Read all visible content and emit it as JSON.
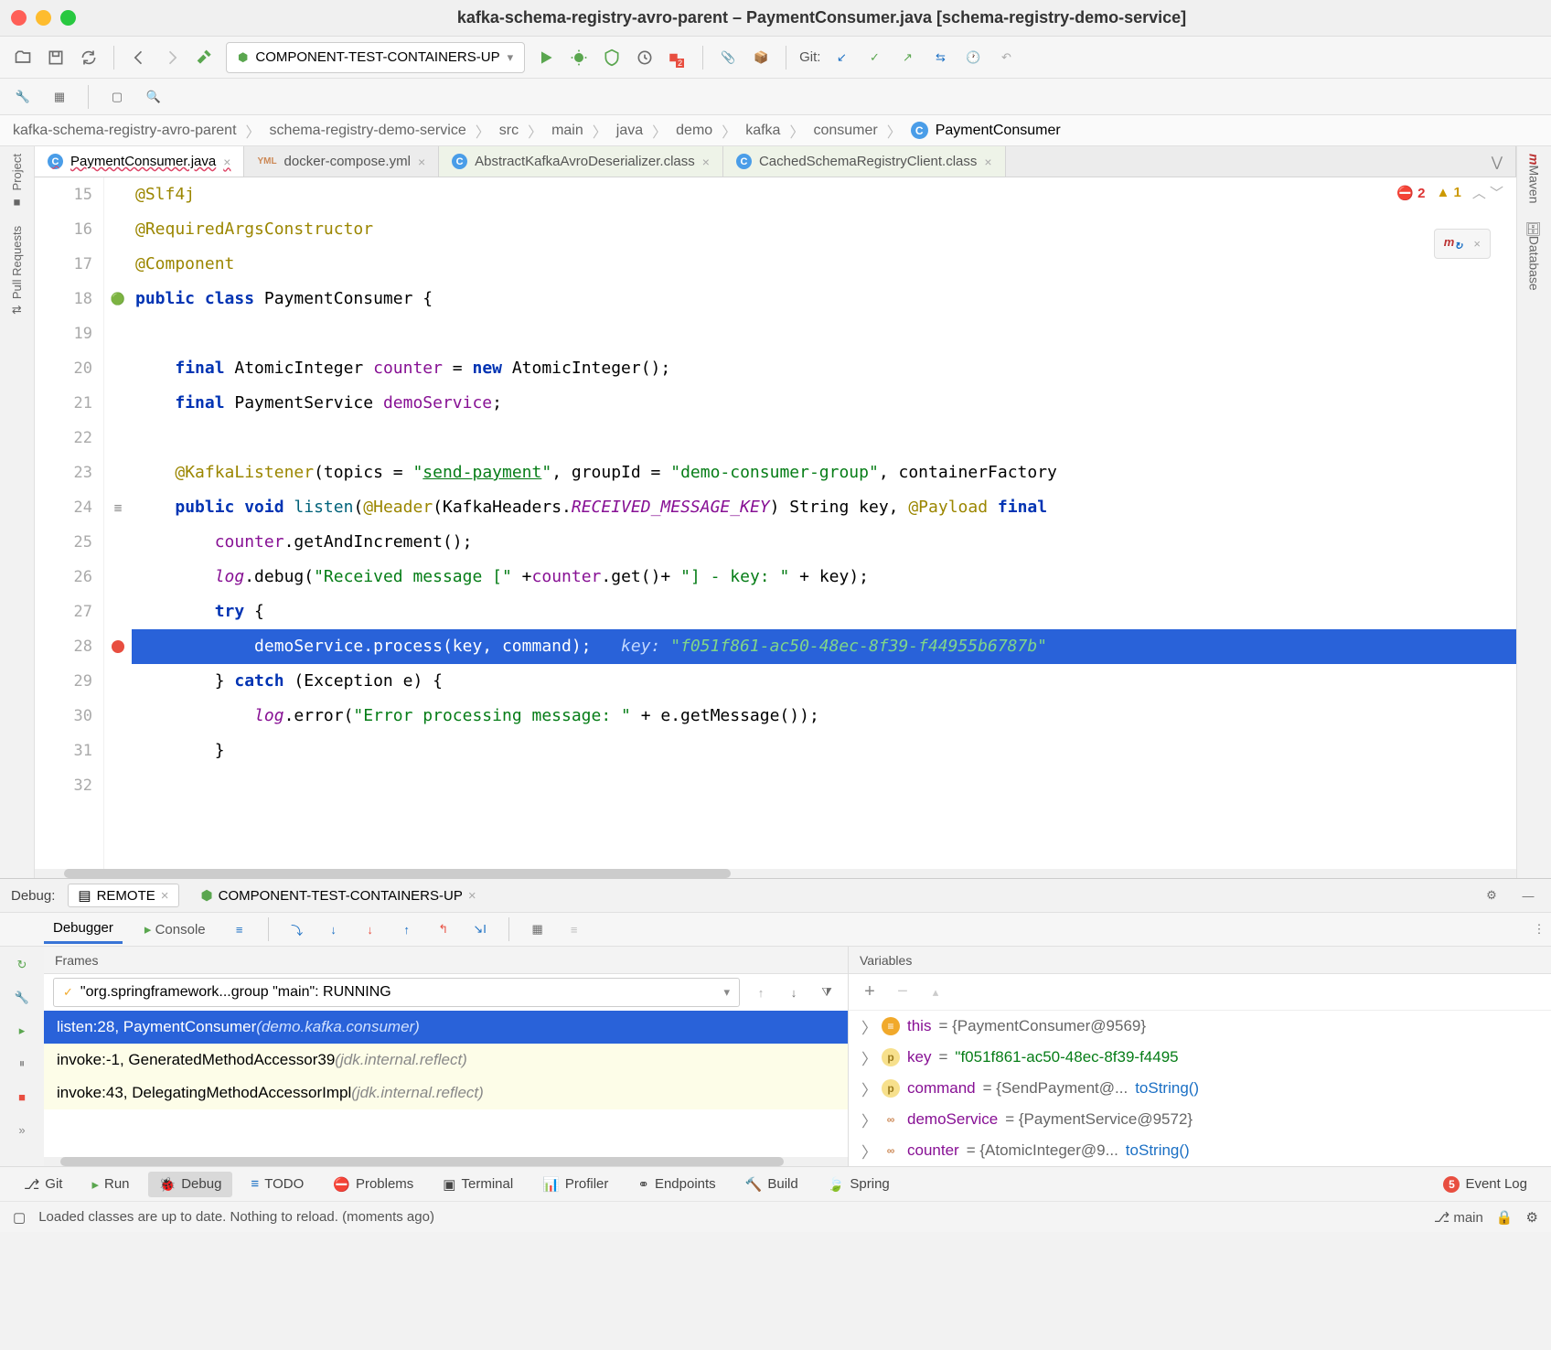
{
  "window": {
    "title": "kafka-schema-registry-avro-parent – PaymentConsumer.java [schema-registry-demo-service]"
  },
  "runConfig": {
    "selected": "COMPONENT-TEST-CONTAINERS-UP",
    "gitLabel": "Git:"
  },
  "breadcrumb": [
    "kafka-schema-registry-avro-parent",
    "schema-registry-demo-service",
    "src",
    "main",
    "java",
    "demo",
    "kafka",
    "consumer",
    "PaymentConsumer"
  ],
  "editorTabs": [
    {
      "label": "PaymentConsumer.java",
      "icon": "c",
      "sel": true
    },
    {
      "label": "docker-compose.yml",
      "icon": "yml",
      "sel": false
    },
    {
      "label": "AbstractKafkaAvroDeserializer.class",
      "icon": "c",
      "sel": false,
      "lib": true
    },
    {
      "label": "CachedSchemaRegistryClient.class",
      "icon": "c",
      "sel": false,
      "lib": true
    }
  ],
  "inspection": {
    "errors": "2",
    "warnings": "1"
  },
  "gutter": [
    "15",
    "16",
    "17",
    "18",
    "19",
    "20",
    "21",
    "22",
    "23",
    "24",
    "25",
    "26",
    "27",
    "28",
    "29",
    "30",
    "31",
    "32"
  ],
  "codePlain": {
    "l15": "@Slf4j",
    "l16": "@RequiredArgsConstructor",
    "l17": "@Component",
    "l23_topic": "send-payment",
    "l23_group": "demo-consumer-group",
    "l26_msg": "Received message [",
    "l26_suffix": "] - key: ",
    "l28_hint_key": "key: ",
    "l28_hint_val": "\"f051f861-ac50-48ec-8f39-f44955b6787b\"",
    "l30_msg": "Error processing message: "
  },
  "leftRail": [
    "Project",
    "Pull Requests"
  ],
  "rightRail": [
    "Maven",
    "Database"
  ],
  "debugHeader": {
    "label": "Debug:",
    "tabs": [
      {
        "label": "REMOTE",
        "sel": true
      },
      {
        "label": "COMPONENT-TEST-CONTAINERS-UP",
        "sel": false
      }
    ]
  },
  "debugTabs": {
    "debugger": "Debugger",
    "console": "Console"
  },
  "framesHeader": "Frames",
  "varsHeader": "Variables",
  "threadSel": "\"org.springframework...group \"main\": RUNNING",
  "frames": [
    {
      "txt": "listen:28, PaymentConsumer ",
      "pkg": "(demo.kafka.consumer)",
      "sel": true
    },
    {
      "txt": "invoke:-1, GeneratedMethodAccessor39 ",
      "pkg": "(jdk.internal.reflect)",
      "lib": true
    },
    {
      "txt": "invoke:43, DelegatingMethodAccessorImpl ",
      "pkg": "(jdk.internal.reflect)",
      "lib": true
    }
  ],
  "vars": [
    {
      "icon": "≡",
      "nm": "this",
      "val": "= {PaymentConsumer@9569}",
      "type": "obj"
    },
    {
      "icon": "p",
      "iconbg": "#f1c232",
      "nm": "key",
      "val": "= ",
      "str": "\"f051f861-ac50-48ec-8f39-f4495",
      "type": "str"
    },
    {
      "icon": "p",
      "iconbg": "#f1c232",
      "nm": "command",
      "val": "= {SendPayment@... ",
      "link": "toString()",
      "type": "obj"
    },
    {
      "icon": "∞",
      "nm": "demoService",
      "val": "= {PaymentService@9572}",
      "type": "obj"
    },
    {
      "icon": "∞",
      "nm": "counter",
      "val": "= {AtomicInteger@9... ",
      "link": "toString()",
      "type": "obj"
    }
  ],
  "bottomTools": [
    {
      "label": "Git",
      "icon": "git"
    },
    {
      "label": "Run",
      "icon": "run"
    },
    {
      "label": "Debug",
      "icon": "bug",
      "sel": true
    },
    {
      "label": "TODO",
      "icon": "todo"
    },
    {
      "label": "Problems",
      "icon": "prob"
    },
    {
      "label": "Terminal",
      "icon": "term"
    },
    {
      "label": "Profiler",
      "icon": "prof"
    },
    {
      "label": "Endpoints",
      "icon": "ep"
    },
    {
      "label": "Build",
      "icon": "build"
    },
    {
      "label": "Spring",
      "icon": "spring"
    },
    {
      "label": "Event Log",
      "icon": "log",
      "badge": "5"
    }
  ],
  "status": {
    "msg": "Loaded classes are up to date. Nothing to reload. (moments ago)",
    "branch": "main"
  }
}
